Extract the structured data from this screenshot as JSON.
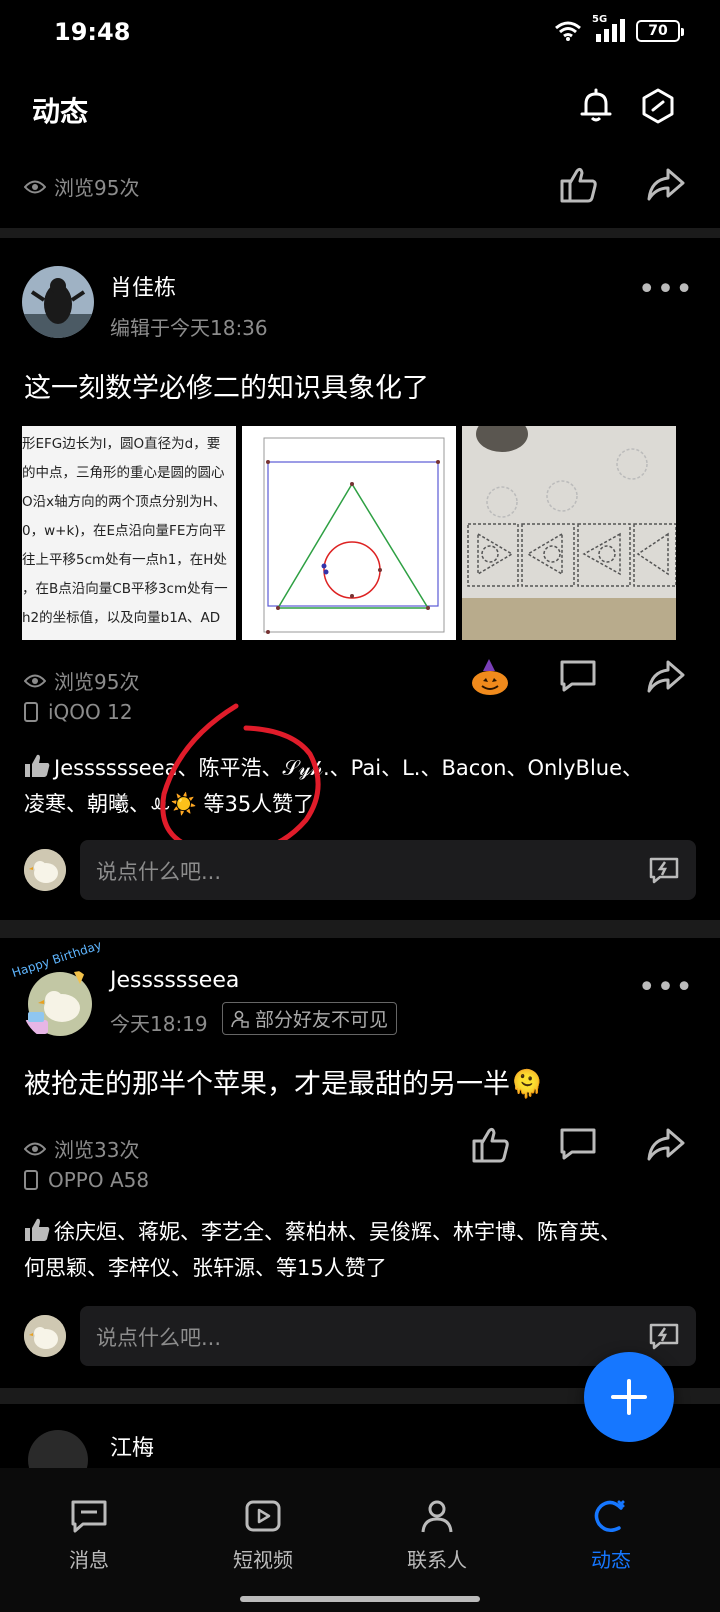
{
  "status_bar": {
    "time": "19:48",
    "network": "5G",
    "battery": "70"
  },
  "header": {
    "title": "动态"
  },
  "prev_post": {
    "views": "浏览95次"
  },
  "post1": {
    "author": "肖佳栋",
    "edited": "编辑于今天18:36",
    "text": "这一刻数学必修二的知识具象化了",
    "image1_lines": [
      "形EFG边长为l，圆O直径为d，要",
      "的中点，三角形的重心是圆的圆心",
      "O沿x轴方向的两个顶点分别为H、",
      "0，w+k)，在E点沿向量FE方向平",
      "往上平移5cm处有一点h1，在H处",
      "，在B点沿向量CB平移3cm处有一",
      "h2的坐标值，以及向量b1A、AD"
    ],
    "views": "浏览95次",
    "device": "iQOO 12",
    "likes_line1": "Jesssssseea、陈平浩、𝒮𝓎𝒽.、Pai、L.、Bacon、OnlyBlue、",
    "likes_line2": "凌寒、朝曦、ꔛ☀️ 等35人赞了",
    "comment_placeholder": "说点什么吧..."
  },
  "post2": {
    "author": "Jesssssseea",
    "time": "今天18:19",
    "privacy": "部分好友不可见",
    "avatar_badge": "Happy Birthday",
    "text": "被抢走的那半个苹果，才是最甜的另一半🫠",
    "views": "浏览33次",
    "device": "OPPO A58",
    "likes_line1": "徐庆烜、蒋妮、李艺全、蔡柏林、吴俊辉、林宇博、陈育英、",
    "likes_line2": "何思颖、李梓仪、张轩源、等15人赞了",
    "comment_placeholder": "说点什么吧..."
  },
  "next_post": {
    "author_partial": "江梅"
  },
  "nav": {
    "items": [
      "消息",
      "短视频",
      "联系人",
      "动态"
    ],
    "active": "动态"
  },
  "colors": {
    "accent": "#1677ff",
    "background": "#000000",
    "annotation": "#e01c2a"
  }
}
